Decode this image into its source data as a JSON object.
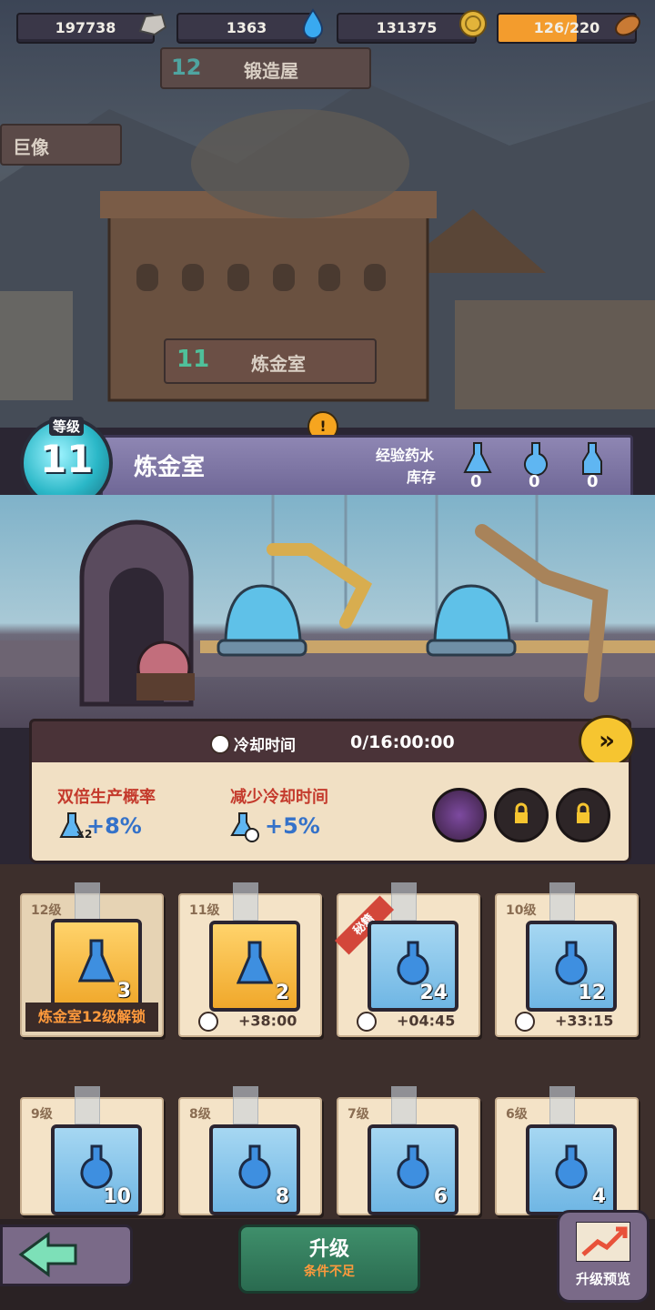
{
  "resources": [
    {
      "value": "197738",
      "icon": "stone-icon"
    },
    {
      "value": "1363",
      "icon": "water-drop-icon"
    },
    {
      "value": "131375",
      "icon": "gold-coin-icon"
    },
    {
      "value": "126/220",
      "icon": "bread-icon"
    }
  ],
  "map_signs": {
    "forge_level": "12",
    "forge_name": "锻造屋",
    "statue_name": "巨像",
    "lab_level": "11",
    "lab_name": "炼金室"
  },
  "building": {
    "level_label": "等级",
    "level": "11",
    "name": "炼金室",
    "exp_potion_label": "经验药水",
    "stock_label": "库存",
    "stock": [
      "0",
      "0",
      "0"
    ]
  },
  "cooldown": {
    "label": "冷却时间",
    "value": "0/16:00:00"
  },
  "buffs": [
    {
      "label": "双倍生产概率",
      "value": "+8%",
      "icon": "double-potion-icon",
      "multiplier": "×2"
    },
    {
      "label": "减少冷却时间",
      "value": "+5%",
      "icon": "potion-clock-icon"
    }
  ],
  "potions": [
    {
      "level": "12级",
      "count": "3",
      "frame": "gold",
      "locked": true,
      "unlock_text": "炼金室12级解锁"
    },
    {
      "level": "11级",
      "count": "2",
      "frame": "gold",
      "time": "+38:00"
    },
    {
      "level": "",
      "count": "24",
      "frame": "blue",
      "time": "+04:45",
      "ribbon": "秘籍"
    },
    {
      "level": "10级",
      "count": "12",
      "frame": "blue",
      "time": "+33:15"
    },
    {
      "level": "9级",
      "count": "10",
      "frame": "blue"
    },
    {
      "level": "8级",
      "count": "8",
      "frame": "blue"
    },
    {
      "level": "7级",
      "count": "6",
      "frame": "blue"
    },
    {
      "level": "6级",
      "count": "4",
      "frame": "blue"
    }
  ],
  "bottom": {
    "upgrade_label": "升级",
    "upgrade_sub": "条件不足",
    "preview_label": "升级预览"
  },
  "colors": {
    "accent_gold": "#f6c530",
    "upgrade_green": "#3f8f6b",
    "buff_text": "#c43a2c",
    "buff_value": "#3572c9"
  }
}
